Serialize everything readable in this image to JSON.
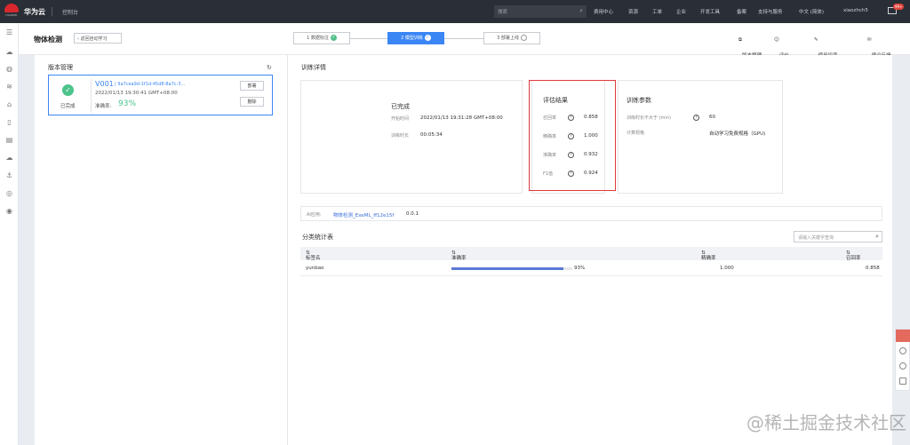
{
  "topbar": {
    "brand": "华为云",
    "console": "控制台",
    "search_placeholder": "搜索",
    "nav": [
      "费用中心",
      "资源",
      "工单",
      "企业",
      "开发工具",
      "备案",
      "支持与服务",
      "中文 (简体)",
      "xiaozhch5"
    ],
    "badge": "99+",
    "colors": {
      "bar": "#2a2e36",
      "logo": "#d9272e"
    }
  },
  "page": {
    "title": "物体检测",
    "back_label": "返回自动学习",
    "steps": [
      {
        "label": "1 数据标注",
        "state": "done"
      },
      {
        "label": "2 模型训练",
        "state": "active"
      },
      {
        "label": "3 部署上线",
        "state": "pending"
      }
    ],
    "header_links": [
      "版本管理",
      "评价",
      "使用指南",
      "建议反馈"
    ]
  },
  "version_panel": {
    "title": "版本管理",
    "version": {
      "name": "V001",
      "id": "| 9a7cea9d-1f1d-45d8-8a7c-3...",
      "time": "2022/01/13 19:30:41 GMT+08:00",
      "status": "已完成",
      "accuracy_label": "准确率:",
      "accuracy": "93%"
    },
    "buttons": {
      "deploy": "部署",
      "delete": "删除"
    }
  },
  "training": {
    "title": "训练详情",
    "status": "已完成",
    "start_label": "开始时间",
    "start_value": "2022/01/13 19:31:28 GMT+08:00",
    "duration_label": "训练时长",
    "duration_value": "00:05:34",
    "eval_title": "评估结果",
    "metrics": [
      {
        "label": "召回率",
        "value": "0.858"
      },
      {
        "label": "精确率",
        "value": "1.000"
      },
      {
        "label": "准确率",
        "value": "0.932"
      },
      {
        "label": "F1值",
        "value": "0.924"
      }
    ],
    "params_title": "训练参数",
    "params": [
      {
        "label": "训练时长不大于 (min)",
        "value": "60",
        "help": true
      },
      {
        "label": "计算规格",
        "value": "自动学习免费规格（GPU)",
        "help": false
      }
    ],
    "ai_app_label": "AI应用:",
    "ai_app_name": "物体检测_ExeML_ff12e15f",
    "ai_app_version": "0.0.1"
  },
  "stats": {
    "title": "分类统计表",
    "search_placeholder": "请输入关键字查询",
    "columns": [
      "标签名",
      "准确率",
      "精确率",
      "召回率"
    ],
    "rows": [
      {
        "label": "yunbao",
        "accuracy": "93%",
        "accuracy_fraction": 0.93,
        "precision": "1.000",
        "recall": "0.858"
      }
    ]
  },
  "watermark": "@稀土掘金技术社区"
}
